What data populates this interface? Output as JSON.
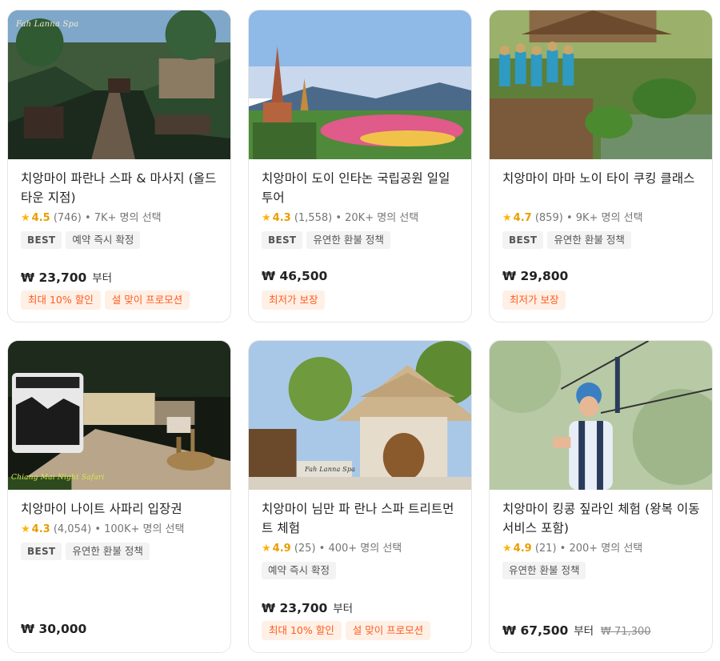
{
  "colors": {
    "accent": "#ff5b1f",
    "star": "#f5a300",
    "tag_bg": "#f3f3f3",
    "promo_bg": "#fff0e6"
  },
  "cards": [
    {
      "image_caption": "Fah Lanna Spa",
      "title": "치앙마이 파란나 스파 & 마사지 (올드 타운 지점)",
      "star": "★",
      "score": "4.5",
      "reviews": "(746)",
      "bookings": "• 7K+ 명의 선택",
      "tags": [
        "BEST",
        "예약 즉시 확정"
      ],
      "price": "₩ 23,700",
      "price_suffix": "부터",
      "promos": [
        "최대 10% 할인",
        "설 맞이 프로모션"
      ]
    },
    {
      "title": "치앙마이 도이 인타논 국립공원 일일 투어",
      "star": "★",
      "score": "4.3",
      "reviews": "(1,558)",
      "bookings": "• 20K+ 명의 선택",
      "tags": [
        "BEST",
        "유연한 환불 정책"
      ],
      "price": "₩ 46,500",
      "promos": [
        "최저가 보장"
      ]
    },
    {
      "title": "치앙마이 마마 노이 타이 쿠킹 클래스",
      "star": "★",
      "score": "4.7",
      "reviews": "(859)",
      "bookings": "• 9K+ 명의 선택",
      "tags": [
        "BEST",
        "유연한 환불 정책"
      ],
      "price": "₩ 29,800",
      "promos": [
        "최저가 보장"
      ]
    },
    {
      "image_caption": "Chiang Mai Night Safari",
      "title": "치앙마이 나이트 사파리 입장권",
      "star": "★",
      "score": "4.3",
      "reviews": "(4,054)",
      "bookings": "• 100K+ 명의 선택",
      "tags": [
        "BEST",
        "유연한 환불 정책"
      ],
      "price": "₩ 30,000"
    },
    {
      "image_caption": "Fah Lanna Spa",
      "title": "치앙마이 님만 파 란나 스파 트리트먼트 체험",
      "star": "★",
      "score": "4.9",
      "reviews": "(25)",
      "bookings": "• 400+ 명의 선택",
      "tags": [
        "예약 즉시 확정"
      ],
      "price": "₩ 23,700",
      "price_suffix": "부터",
      "promos": [
        "최대 10% 할인",
        "설 맞이 프로모션"
      ]
    },
    {
      "title": "치앙마이 킹콩 짚라인 체험 (왕복 이동 서비스 포함)",
      "star": "★",
      "score": "4.9",
      "reviews": "(21)",
      "bookings": "• 200+ 명의 선택",
      "tags": [
        "유연한 환불 정책"
      ],
      "price": "₩ 67,500",
      "price_suffix": "부터",
      "original_price": "₩ 71,300"
    }
  ]
}
